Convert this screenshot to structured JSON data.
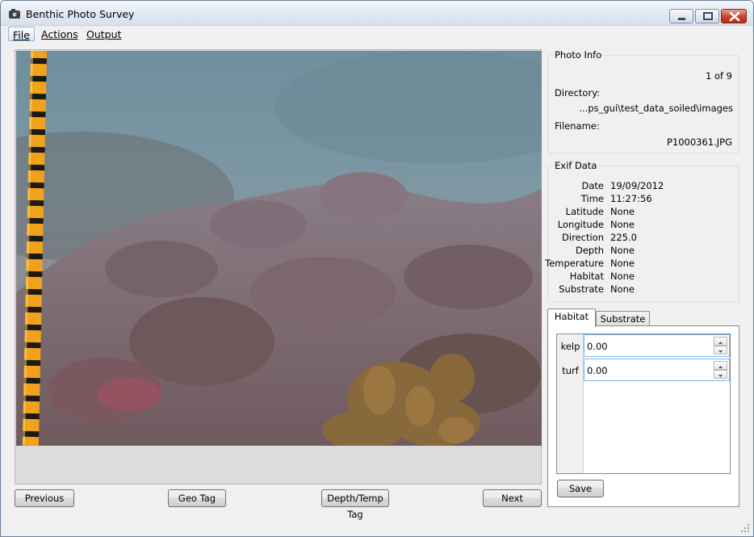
{
  "window": {
    "title": "Benthic Photo Survey",
    "controls": {
      "minimize_icon": "minimize-icon",
      "maximize_icon": "maximize-icon",
      "close_icon": "close-icon"
    }
  },
  "menu": {
    "items": [
      {
        "label": "File",
        "accent": "F"
      },
      {
        "label": "Actions",
        "accent": "A"
      },
      {
        "label": "Output",
        "accent": "O"
      }
    ]
  },
  "navigation": {
    "previous": "Previous",
    "geo_tag": "Geo Tag",
    "depth_temp_tag": "Depth/Temp Tag",
    "next": "Next"
  },
  "photo_info": {
    "title": "Photo Info",
    "counter": "1 of 9",
    "directory_label": "Directory:",
    "directory_value": "...ps_gui\\test_data_soiled\\images",
    "filename_label": "Filename:",
    "filename_value": "P1000361.JPG"
  },
  "exif": {
    "title": "Exif Data",
    "rows": [
      {
        "label": "Date",
        "value": "19/09/2012"
      },
      {
        "label": "Time",
        "value": "11:27:56"
      },
      {
        "label": "Latitude",
        "value": "None"
      },
      {
        "label": "Longitude",
        "value": "None"
      },
      {
        "label": "Direction",
        "value": "225.0"
      },
      {
        "label": "Depth",
        "value": "None"
      },
      {
        "label": "Temperature",
        "value": "None"
      },
      {
        "label": "Habitat",
        "value": "None"
      },
      {
        "label": "Substrate",
        "value": "None"
      }
    ]
  },
  "tabs": {
    "items": [
      "Habitat",
      "Substrate"
    ],
    "active": "Habitat"
  },
  "habitat": {
    "rows": [
      {
        "label": "kelp",
        "value": "0.00"
      },
      {
        "label": "turf",
        "value": "0.00"
      }
    ],
    "save": "Save"
  },
  "colors": {
    "focus_border": "#7eb4ea",
    "close_button": "#c8432d"
  }
}
